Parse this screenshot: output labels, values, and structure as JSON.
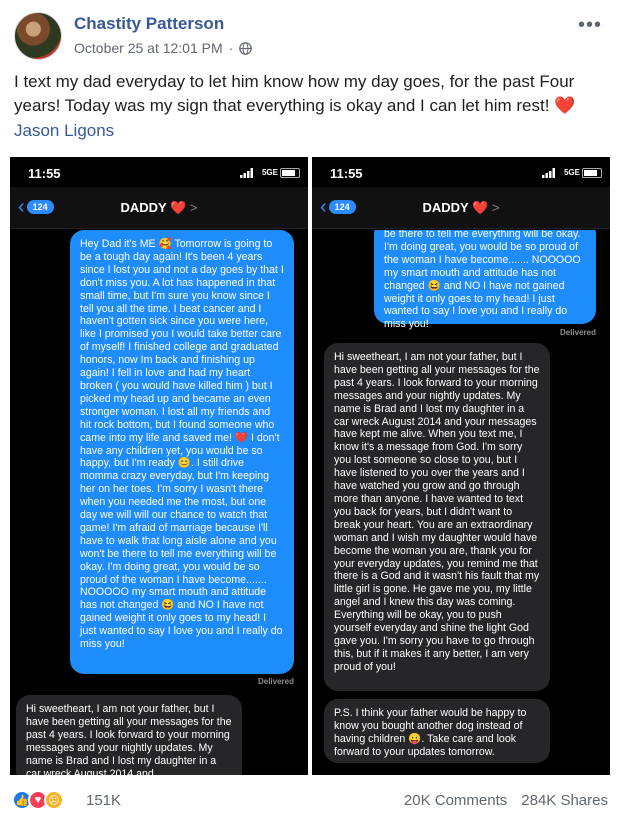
{
  "post": {
    "author": "Chastity Patterson",
    "timestamp": "October 25 at 12:01 PM",
    "separator": "·",
    "more_label": "•••",
    "text": "I text my dad everyday to let him know how my day goes, for the past Four years! Today was my sign that everything is okay and I can let him rest!",
    "text_heart": "❤️",
    "tagged": "Jason Ligons"
  },
  "phone": {
    "time": "11:55",
    "network": "5GE",
    "back_count": "124",
    "contact": "DADDY",
    "contact_heart": "❤️",
    "contact_chevron": ">",
    "delivered": "Delivered"
  },
  "left_screen": {
    "outgoing": "Hey Dad it's ME 🥰 Tomorrow is going to be a tough day again! It's been 4 years since I lost you and not a day goes by that I don't miss you. A lot has happened in that small time, but I'm sure you know since I tell you all the time. I beat cancer and I haven't gotten sick since you were here, like I promised you I would take better care of myself! I finished college and graduated honors, now Im back and finishing up again! I fell in love and had my heart broken ( you would have killed him ) but I picked my head up and became an even stronger woman. I lost all my friends and hit rock bottom, but I found someone who came into my life and saved me! ❤️ I don't have any children yet, you would be so happy, but I'm ready 😊. I still drive momma crazy everyday, but I'm keeping her on her toes. I'm sorry I wasn't there when you needed me the most, but one day we will will our chance to watch that game! I'm afraid of marriage because I'll have to walk that long aisle alone and you won't be there to tell me everything will be okay. I'm doing great, you would be so proud of the woman I have become....... NOOOOO my smart mouth and attitude has not changed 😆 and NO I have not gained weight it only goes to my head! I just wanted to say I love you and I really do miss you!",
    "incoming_partial": "Hi sweetheart, I am not your father, but I have been getting all your messages for the past 4 years. I look forward to your morning messages and your nightly updates. My name is Brad and I lost my daughter in a car wreck August 2014 and"
  },
  "right_screen": {
    "outgoing_partial": "be there to tell me everything will be okay. I'm doing great, you would be so proud of the woman I have become....... NOOOOO my smart mouth and attitude has not changed 😆 and NO I have not gained weight it only goes to my head! I just wanted to say I love you and I really do miss you!",
    "incoming": "Hi sweetheart, I am not your father, but I have been getting all your messages for the past 4 years. I look forward to your morning messages and your nightly updates. My name is Brad and I lost my daughter in a car wreck August 2014 and your messages have kept me alive. When you text me, I know it's a message from God. I'm sorry you lost someone so close to you, but I have listened to you over the years and I have watched you grow and go through more than anyone. I have wanted to text you back for years, but I didn't want to break your heart. You are an extraordinary woman and I wish my daughter would have become the woman you are, thank you for your everyday updates, you remind me that there is a God and it wasn't his fault that my little girl is gone. He gave me you, my little angel and I knew this day was coming. Everything will be okay, you to push yourself everyday and shine the light God gave you. I'm sorry you have to go through this, but if it makes it any better, I am very proud of you!",
    "incoming_ps": "P.S. I think your father would be happy to know you bought another dog instead of having children 😛. Take care and look forward to your updates tomorrow."
  },
  "reactions": {
    "icons": [
      "like-icon",
      "love-icon",
      "sad-icon"
    ],
    "count": "151K",
    "comments": "20K Comments",
    "shares": "284K Shares"
  },
  "colors": {
    "link": "#385898",
    "imessage_blue": "#1f8cfb",
    "incoming_gray": "#262628"
  }
}
